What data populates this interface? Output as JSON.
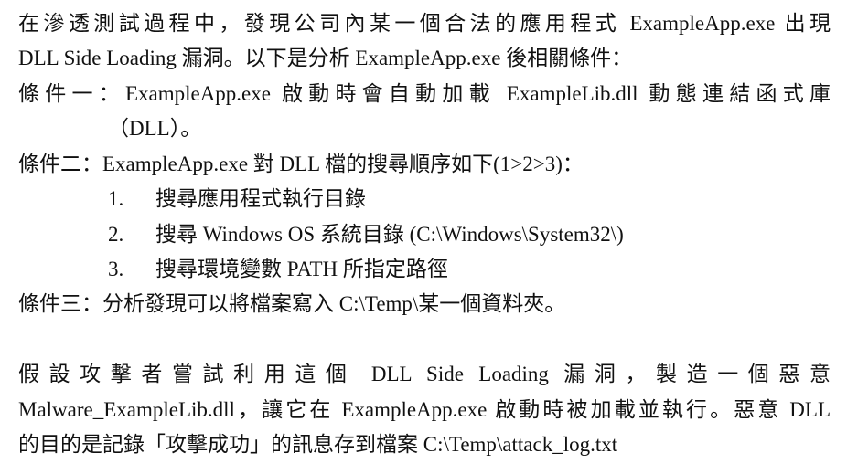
{
  "intro": {
    "line1": "在滲透測試過程中，發現公司內某一個合法的應用程式 ExampleApp.exe 出現",
    "line2": "DLL Side Loading 漏洞。以下是分析 ExampleApp.exe 後相關條件："
  },
  "conditions": {
    "c1_line1": "條件一：ExampleApp.exe 啟動時會自動加載 ExampleLib.dll 動態連結函式庫",
    "c1_line2": "（DLL）。",
    "c2": "條件二：ExampleApp.exe 對 DLL 檔的搜尋順序如下(1>2>3)：",
    "search_order": [
      {
        "num": "1.",
        "text": "搜尋應用程式執行目錄"
      },
      {
        "num": "2.",
        "text": "搜尋 Windows OS 系統目錄 (C:\\Windows\\System32\\)"
      },
      {
        "num": "3.",
        "text": "搜尋環境變數 PATH 所指定路徑"
      }
    ],
    "c3": "條件三：分析發現可以將檔案寫入 C:\\Temp\\某一個資料夾。"
  },
  "scenario": {
    "line1": "假設攻擊者嘗試利用這個 DLL Side Loading 漏洞，製造一個惡意",
    "line2": "Malware_ExampleLib.dll，讓它在 ExampleApp.exe 啟動時被加載並執行。惡意 DLL",
    "line3": "的目的是記錄「攻擊成功」的訊息存到檔案 C:\\Temp\\attack_log.txt"
  }
}
